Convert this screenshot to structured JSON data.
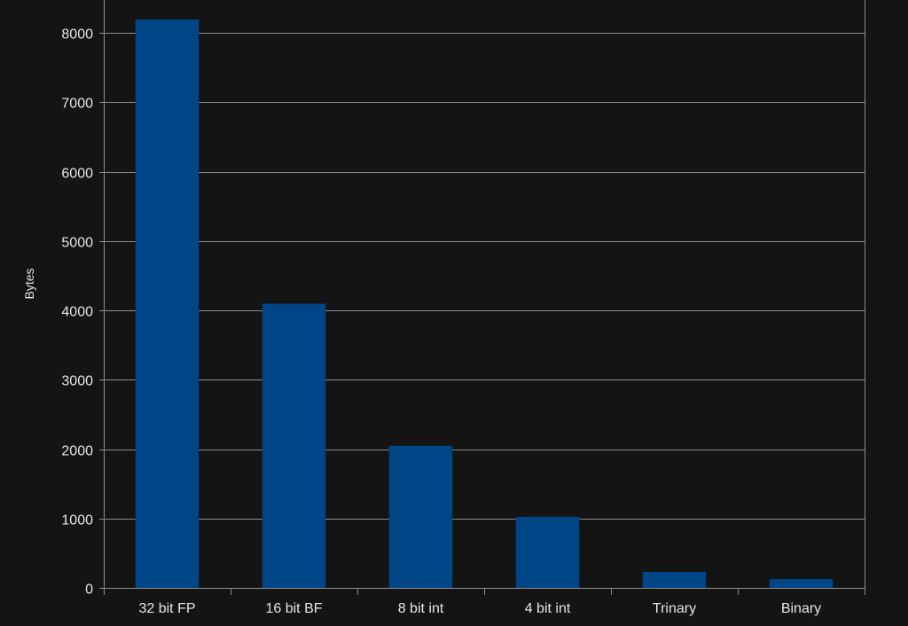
{
  "chart_data": {
    "type": "bar",
    "title": "",
    "xlabel": "",
    "ylabel": "Bytes",
    "categories": [
      "32 bit FP",
      "16 bit BF",
      "8 bit int",
      "4 bit int",
      "Trinary",
      "Binary"
    ],
    "values": [
      8192,
      4096,
      2048,
      1024,
      232,
      128
    ],
    "ylim": [
      0,
      8000
    ],
    "yticks": [
      0,
      1000,
      2000,
      3000,
      4000,
      5000,
      6000,
      7000,
      8000
    ],
    "grid": true,
    "legend": "none",
    "colors": {
      "background": "#141414",
      "bar": "#004586",
      "grid": "#8c8c8c",
      "text": "#e6e6e6"
    }
  }
}
